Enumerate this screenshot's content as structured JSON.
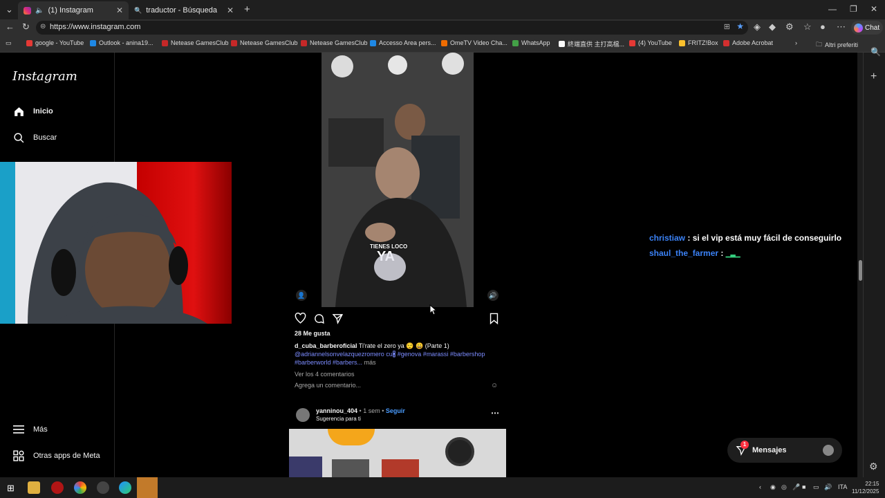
{
  "browser": {
    "tabs": [
      {
        "title": "(1) Instagram"
      },
      {
        "title": "traductor - Búsqueda"
      }
    ],
    "url": "https://www.instagram.com",
    "chat_label": "Chat",
    "bookmarks": [
      {
        "label": "google - YouTube",
        "color": "#e53935"
      },
      {
        "label": "Outlook - anina19...",
        "color": "#1e88e5"
      },
      {
        "label": "Netease GamesClub",
        "color": "#c62828"
      },
      {
        "label": "Netease GamesClub",
        "color": "#c62828"
      },
      {
        "label": "Netease GamesClub",
        "color": "#c62828"
      },
      {
        "label": "Accesso Area pers...",
        "color": "#1e88e5"
      },
      {
        "label": "OmeTV Video Cha...",
        "color": "#ef6c00"
      },
      {
        "label": "WhatsApp",
        "color": "#43a047"
      },
      {
        "label": "終端直供 主打高檔...",
        "color": "#fafafa"
      },
      {
        "label": "(4) YouTube",
        "color": "#e53935"
      },
      {
        "label": "FRITZ!Box",
        "color": "#fbc02d"
      },
      {
        "label": "Adobe Acrobat",
        "color": "#d32f2f"
      }
    ],
    "other_favorites": "Altri preferiti"
  },
  "sidebar": {
    "logo": "Instagram",
    "items": [
      {
        "label": "Inicio"
      },
      {
        "label": "Buscar"
      }
    ],
    "bottom": [
      {
        "label": "Más"
      },
      {
        "label": "Otras apps de Meta"
      }
    ]
  },
  "post": {
    "overlay_text_1": "TIENES LOCO",
    "overlay_text_2": "YA",
    "likes": "28 Me gusta",
    "author": "d_cuba_barberoficial",
    "caption": "Ti'rate el zero ya 😌 😀 (Parte 1)",
    "mention": "@adriannelsonvelazquezromero",
    "tags_line1": "cu🖁 #genova #marassi #barbershop",
    "tags_line2": "#barberworld #barbers...",
    "more": "más",
    "view_comments": "Ver los 4 comentarios",
    "add_comment": "Agrega un comentario..."
  },
  "next_post": {
    "username": "yanninou_404",
    "time": "• 1 sem •",
    "follow": "Seguir",
    "subtitle": "Sugerencia para ti"
  },
  "chat_overlay": [
    {
      "user": "christiaw",
      "message": ": si el vip está muy fácil de conseguirlo"
    },
    {
      "user": "shaul_the_farmer",
      "message": ":"
    }
  ],
  "messages": {
    "label": "Mensajes",
    "badge": "1"
  },
  "taskbar": {
    "lang": "ITA",
    "time": "22:15",
    "date": "11/12/2025"
  }
}
